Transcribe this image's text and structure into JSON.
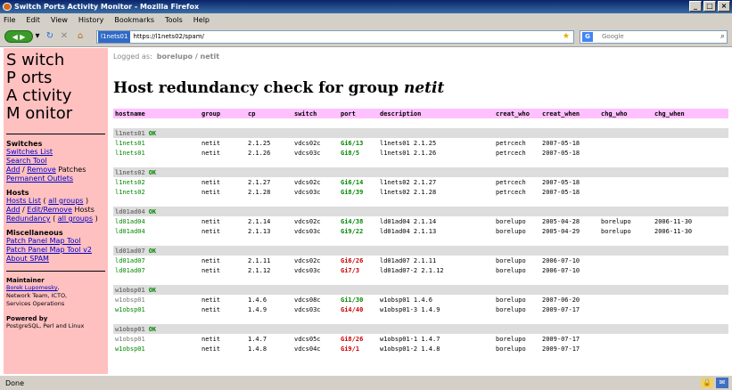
{
  "window": {
    "title": "Switch Ports Activity Monitor - Mozilla Firefox"
  },
  "menu": [
    "File",
    "Edit",
    "View",
    "History",
    "Bookmarks",
    "Tools",
    "Help"
  ],
  "nav": {
    "site_label": "l1nets01",
    "url": "https://l1nets02/spam/",
    "search_placeholder": "Google"
  },
  "sidebar": {
    "logo": [
      "S witch",
      "P orts",
      "A ctivity",
      "M onitor"
    ],
    "switches": {
      "title": "Switches",
      "switches_list": "Switches List",
      "search_tool": "Search Tool",
      "add": "Add",
      "sep": " / ",
      "remove": "Remove",
      "patches": " Patches",
      "permanent_outlets": "Permanent Outlets"
    },
    "hosts": {
      "title": "Hosts",
      "hosts_list": "Hosts List",
      "paren_open": " ( ",
      "all_groups": "all groups",
      "paren_close": " )",
      "add": "Add",
      "sep": " / ",
      "edit_remove": "Edit/Remove",
      "hosts_word": " Hosts",
      "redundancy": "Redundancy"
    },
    "misc": {
      "title": "Miscellaneous",
      "ppmt": "Patch Panel Map Tool",
      "ppmt2": "Patch Panel Map Tool v2",
      "about": "About SPAM"
    },
    "maintainer": {
      "title": "Maintainer",
      "name": "Borek Lupomesky",
      "comma": ",",
      "line2": "Network Team, ICTO,",
      "line3": "Services Operations"
    },
    "powered": {
      "title": "Powered by",
      "text": "PostgreSQL, Perl and Linux"
    }
  },
  "main": {
    "logged_prefix": "Logged as:",
    "logged_user": "borelupo / netit",
    "heading_prefix": "Host redundancy check for group ",
    "heading_group": "netit",
    "columns": [
      "hostname",
      "group",
      "cp",
      "switch",
      "port",
      "description",
      "creat_who",
      "creat_when",
      "chg_who",
      "chg_when"
    ],
    "groups": [
      {
        "name": "l1nets01",
        "status": "OK",
        "rows": [
          {
            "host": "l1nets01",
            "group": "netit",
            "cp": "2.1.25",
            "switch": "vdcs02c",
            "port": "Gi6/13",
            "port_color": "green",
            "desc": "l1nets01 2.1.25",
            "creat_who": "petrcech",
            "creat_when": "2007-05-18",
            "chg_who": "",
            "chg_when": "",
            "host_color": "green"
          },
          {
            "host": "l1nets01",
            "group": "netit",
            "cp": "2.1.26",
            "switch": "vdcs03c",
            "port": "Gi8/5",
            "port_color": "green",
            "desc": "l1nets01 2.1.26",
            "creat_who": "petrcech",
            "creat_when": "2007-05-18",
            "chg_who": "",
            "chg_when": "",
            "host_color": "green"
          }
        ]
      },
      {
        "name": "l1nets02",
        "status": "OK",
        "rows": [
          {
            "host": "l1nets02",
            "group": "netit",
            "cp": "2.1.27",
            "switch": "vdcs02c",
            "port": "Gi6/14",
            "port_color": "green",
            "desc": "l1nets02 2.1.27",
            "creat_who": "petrcech",
            "creat_when": "2007-05-18",
            "chg_who": "",
            "chg_when": "",
            "host_color": "green"
          },
          {
            "host": "l1nets02",
            "group": "netit",
            "cp": "2.1.28",
            "switch": "vdcs03c",
            "port": "Gi8/39",
            "port_color": "green",
            "desc": "l1nets02 2.1.28",
            "creat_who": "petrcech",
            "creat_when": "2007-05-18",
            "chg_who": "",
            "chg_when": "",
            "host_color": "green"
          }
        ]
      },
      {
        "name": "ld01ad04",
        "status": "OK",
        "rows": [
          {
            "host": "ld01ad04",
            "group": "netit",
            "cp": "2.1.14",
            "switch": "vdcs02c",
            "port": "Gi4/38",
            "port_color": "green",
            "desc": "ld01ad04 2.1.14",
            "creat_who": "borelupo",
            "creat_when": "2005-04-28",
            "chg_who": "borelupo",
            "chg_when": "2006-11-30",
            "host_color": "green"
          },
          {
            "host": "ld01ad04",
            "group": "netit",
            "cp": "2.1.13",
            "switch": "vdcs03c",
            "port": "Gi9/22",
            "port_color": "green",
            "desc": "ld01ad04 2.1.13",
            "creat_who": "borelupo",
            "creat_when": "2005-04-29",
            "chg_who": "borelupo",
            "chg_when": "2006-11-30",
            "host_color": "green"
          }
        ]
      },
      {
        "name": "ld01ad07",
        "status": "OK",
        "rows": [
          {
            "host": "ld01ad07",
            "group": "netit",
            "cp": "2.1.11",
            "switch": "vdcs02c",
            "port": "Gi6/26",
            "port_color": "red",
            "desc": "ld01ad07 2.1.11",
            "creat_who": "borelupo",
            "creat_when": "2006-07-10",
            "chg_who": "",
            "chg_when": "",
            "host_color": "green"
          },
          {
            "host": "ld01ad07",
            "group": "netit",
            "cp": "2.1.12",
            "switch": "vdcs03c",
            "port": "Gi7/3",
            "port_color": "red",
            "desc": "ld01ad07-2 2.1.12",
            "creat_who": "borelupo",
            "creat_when": "2006-07-10",
            "chg_who": "",
            "chg_when": "",
            "host_color": "green"
          }
        ]
      },
      {
        "name": "w1obsp01",
        "status": "OK",
        "rows": [
          {
            "host": "w1obsp01",
            "group": "netit",
            "cp": "1.4.6",
            "switch": "vdcs08c",
            "port": "Gi1/30",
            "port_color": "green",
            "desc": "w1obsp01 1.4.6",
            "creat_who": "borelupo",
            "creat_when": "2007-06-20",
            "chg_who": "",
            "chg_when": "",
            "host_color": "gray"
          },
          {
            "host": "w1obsp01",
            "group": "netit",
            "cp": "1.4.9",
            "switch": "vdcs03c",
            "port": "Gi4/40",
            "port_color": "red",
            "desc": "w1obsp01-3 1.4.9",
            "creat_who": "borelupo",
            "creat_when": "2009-07-17",
            "chg_who": "",
            "chg_when": "",
            "host_color": "green"
          }
        ]
      },
      {
        "name": "w1obsp01",
        "status": "OK",
        "rows": [
          {
            "host": "w1obsp01",
            "group": "netit",
            "cp": "1.4.7",
            "switch": "vdcs05c",
            "port": "Gi8/26",
            "port_color": "red",
            "desc": "w1obsp01-1 1.4.7",
            "creat_who": "borelupo",
            "creat_when": "2009-07-17",
            "chg_who": "",
            "chg_when": "",
            "host_color": "gray"
          },
          {
            "host": "w1obsp01",
            "group": "netit",
            "cp": "1.4.8",
            "switch": "vdcs04c",
            "port": "Gi9/1",
            "port_color": "red",
            "desc": "w1obsp01-2 1.4.8",
            "creat_who": "borelupo",
            "creat_when": "2009-07-17",
            "chg_who": "",
            "chg_when": "",
            "host_color": "green"
          }
        ]
      }
    ]
  },
  "statusbar": {
    "text": "Done"
  },
  "colors": {
    "sidebar_bg": "#ffc0c0",
    "header_bg": "#ffc0ff",
    "group_bg": "#dddddd",
    "port_green": "#008800",
    "port_red": "#cc0000"
  }
}
